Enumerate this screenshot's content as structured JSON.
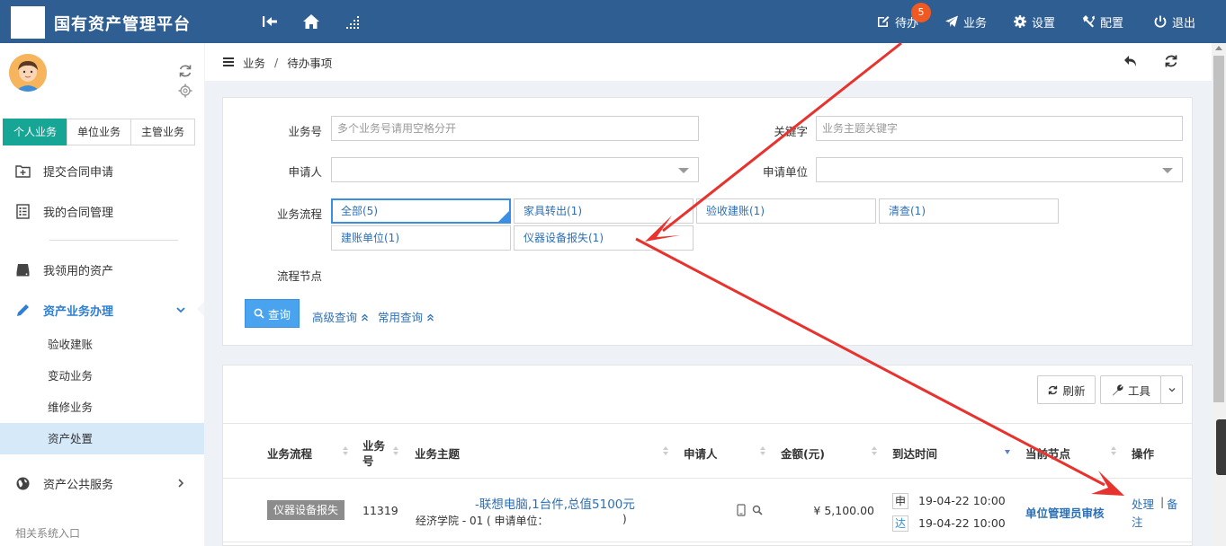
{
  "header": {
    "title": "国有资产管理平台",
    "todo_badge": "5",
    "nav": [
      {
        "label": "待办",
        "icon": "edit-icon"
      },
      {
        "label": "业务",
        "icon": "paper-plane-icon"
      },
      {
        "label": "设置",
        "icon": "gear-icon"
      },
      {
        "label": "配置",
        "icon": "tools-icon"
      },
      {
        "label": "退出",
        "icon": "power-icon"
      }
    ]
  },
  "sidebar": {
    "tabs": [
      "个人业务",
      "单位业务",
      "主管业务"
    ],
    "items": [
      {
        "label": "提交合同申请"
      },
      {
        "label": "我的合同管理"
      },
      {
        "label": "我领用的资产"
      },
      {
        "label": "资产业务办理"
      },
      {
        "label": "资产公共服务"
      }
    ],
    "sub_items": [
      "验收建账",
      "变动业务",
      "维修业务",
      "资产处置"
    ],
    "footer": "相关系统入口"
  },
  "breadcrumb": {
    "parent": "业务",
    "sep": "/",
    "current": "待办事项"
  },
  "filters": {
    "biz_no_label": "业务号",
    "biz_no_placeholder": "多个业务号请用空格分开",
    "keyword_label": "关键字",
    "keyword_placeholder": "业务主题关键字",
    "applicant_label": "申请人",
    "dept_label": "申请单位",
    "flow_label": "业务流程",
    "node_label": "流程节点",
    "flows": [
      "全部(5)",
      "家具转出(1)",
      "验收建账(1)",
      "清查(1)",
      "建账单位(1)",
      "仪器设备报失(1)"
    ],
    "query_button": "查询",
    "advanced_query": "高级查询",
    "common_query": "常用查询"
  },
  "toolbar": {
    "refresh": "刷新",
    "tools": "工具"
  },
  "table": {
    "headers": {
      "flow": "业务流程",
      "biz_no_1": "业务",
      "biz_no_2": "号",
      "subject": "业务主题",
      "applicant": "申请人",
      "amount": "金额(元)",
      "arrival": "到达时间",
      "node": "当前节点",
      "action": "操作"
    },
    "rows": [
      {
        "flow": "仪器设备报失",
        "biz_no": "11319",
        "subject_title": "-联想电脑,1台件,总值5100元",
        "subject_sub": "经济学院 - 01 ( 申请单位：",
        "subject_tail": ")",
        "amount": "¥ 5,100.00",
        "tag_apply": "申",
        "time_apply": "19-04-22 10:00",
        "tag_arrive": "达",
        "time_arrive": "19-04-22 10:00",
        "node": "单位管理员审核",
        "action_process": "处理",
        "action_sep": "|",
        "action_note_1": "备",
        "action_note_2": "注"
      }
    ]
  },
  "colors": {
    "header": "#2f5f92",
    "accent_teal": "#17a595",
    "link": "#2d6fb4",
    "badge": "#f05a22",
    "annotation": "#e8322e"
  }
}
